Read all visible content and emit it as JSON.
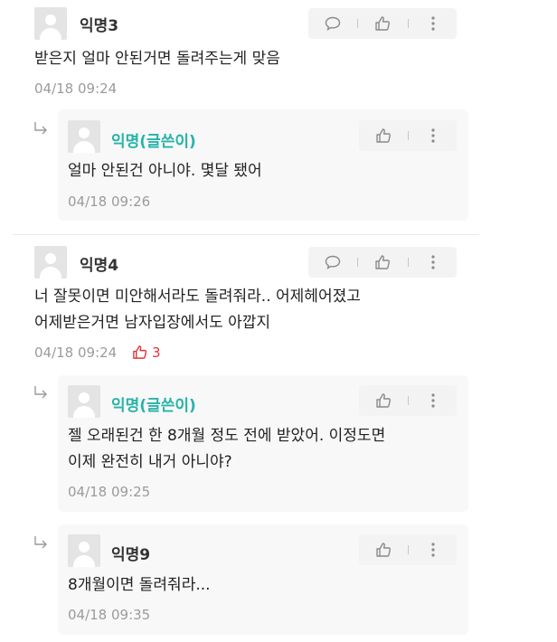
{
  "comments": [
    {
      "author": "익명3",
      "text_lines": [
        "받은지 얼마 안된거면 돌려주는게 맞음"
      ],
      "timestamp": "04/18 09:24",
      "reply": {
        "author": "익명(글쓴이)",
        "text_lines": [
          "얼마 안된건 아니야. 몇달 됐어"
        ],
        "timestamp": "04/18 09:26"
      }
    },
    {
      "author": "익명4",
      "text_lines": [
        "너 잘못이면 미안해서라도 돌려줘라.. 어제헤어졌고",
        "어제받은거면 남자입장에서도 아깝지"
      ],
      "timestamp": "04/18 09:24",
      "likes": "3",
      "replies": [
        {
          "author": "익명(글쓴이)",
          "text_lines": [
            "젤 오래된건 한 8개월 정도 전에 받았어. 이정도면",
            "이제 완전히 내거 아니야?"
          ],
          "timestamp": "04/18 09:25"
        },
        {
          "author": "익명9",
          "text_lines": [
            "8개월이면 돌려줘라..."
          ],
          "timestamp": "04/18 09:35"
        }
      ]
    }
  ],
  "colors": {
    "author_name": "#27b3a8",
    "like_count": "#e0343d",
    "timestamp": "#9b9b9b"
  },
  "icons": [
    "avatar-placeholder",
    "comment-icon",
    "thumbs-up-icon",
    "more-vertical-icon",
    "reply-arrow-icon"
  ]
}
